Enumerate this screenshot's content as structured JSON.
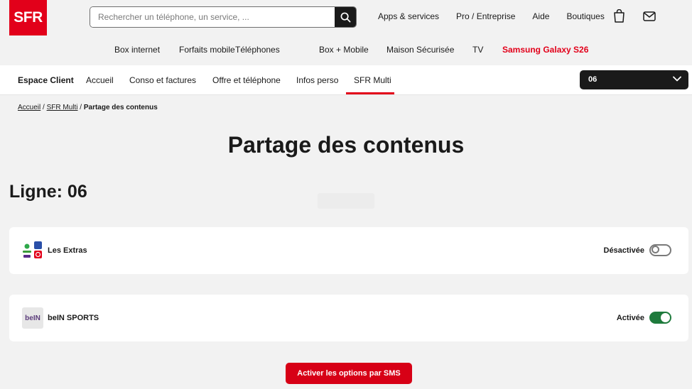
{
  "brand": {
    "logo_text": "SFR",
    "accent": "#e2001a"
  },
  "search": {
    "placeholder": "Rechercher un téléphone, un service, ..."
  },
  "top_links": [
    "Apps & services",
    "Pro / Entreprise",
    "Aide",
    "Boutiques"
  ],
  "main_nav": [
    {
      "label": "Box internet"
    },
    {
      "label": "Forfaits mobile"
    },
    {
      "label": "Téléphones"
    },
    {
      "label": "Box + Mobile"
    },
    {
      "label": "Maison Sécurisée"
    },
    {
      "label": "TV"
    },
    {
      "label": "Samsung Galaxy S26",
      "highlight": true
    }
  ],
  "sub_nav": {
    "title": "Espace Client",
    "items": [
      "Accueil",
      "Conso et factures",
      "Offre et téléphone",
      "Infos perso",
      "SFR Multi"
    ],
    "active": "SFR Multi"
  },
  "line_selector": {
    "value": "06"
  },
  "breadcrumb": {
    "items": [
      "Accueil",
      "SFR Multi"
    ],
    "current": "Partage des contenus"
  },
  "page": {
    "title": "Partage des contenus",
    "ligne_label": "Ligne: 06"
  },
  "contents": [
    {
      "name": "Les Extras",
      "status": "Désactivée",
      "enabled": false,
      "icon": "les-extras-logo"
    },
    {
      "name": "beIN SPORTS",
      "status": "Activée",
      "enabled": true,
      "icon": "bein-sports-logo",
      "logo_text": "beIN"
    }
  ],
  "actions": {
    "sms_button": "Activer les options par SMS"
  },
  "colors": {
    "toggle_on": "#1e7a3c",
    "primary_button": "#d70016"
  }
}
